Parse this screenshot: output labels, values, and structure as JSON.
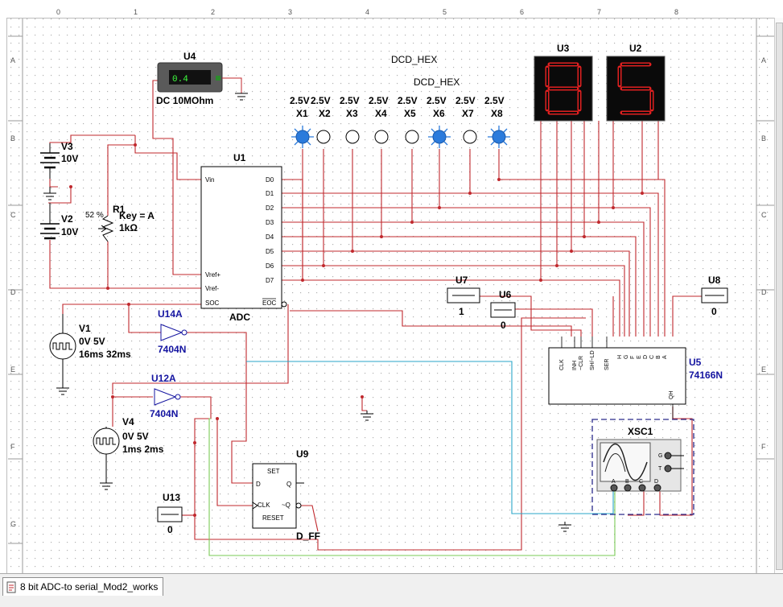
{
  "colors": {
    "wire_red": "#c0282d",
    "wire_blue": "#2aa6c8",
    "wire_green": "#7acb56",
    "probe_blue": "#2b7bdc",
    "segment_red": "#e02020",
    "component_navy": "#1414a0",
    "dashed_border": "#2a2a8a"
  },
  "ruler": {
    "cols": [
      "0",
      "1",
      "2",
      "3",
      "4",
      "5",
      "6",
      "7",
      "8"
    ],
    "rows": [
      "A",
      "B",
      "C",
      "D",
      "E",
      "F",
      "G"
    ]
  },
  "schematic": {
    "u4": {
      "ref": "U4",
      "display": "0.4",
      "desc": "DC  10MOhm"
    },
    "dcd_hex_1": "DCD_HEX",
    "dcd_hex_2": "DCD_HEX",
    "u3": {
      "ref": "U3",
      "digit": "8"
    },
    "u2": {
      "ref": "U2",
      "digit": "5"
    },
    "probes": [
      {
        "volt": "2.5V",
        "name": "X1",
        "lit": true
      },
      {
        "volt": "2.5V",
        "name": "X2",
        "lit": false
      },
      {
        "volt": "2.5V",
        "name": "X3",
        "lit": false
      },
      {
        "volt": "2.5V",
        "name": "X4",
        "lit": false
      },
      {
        "volt": "2.5V",
        "name": "X5",
        "lit": false
      },
      {
        "volt": "2.5V",
        "name": "X6",
        "lit": true
      },
      {
        "volt": "2.5V",
        "name": "X7",
        "lit": false
      },
      {
        "volt": "2.5V",
        "name": "X8",
        "lit": true
      }
    ],
    "u1": {
      "ref": "U1",
      "label": "ADC",
      "pins_left": [
        "Vin",
        "Vref+",
        "Vref-",
        "SOC"
      ],
      "pins_right": [
        "D0",
        "D1",
        "D2",
        "D3",
        "D4",
        "D5",
        "D6",
        "D7",
        "EOC"
      ]
    },
    "v3": {
      "ref": "V3",
      "value": "10V"
    },
    "v2": {
      "ref": "V2",
      "value": "10V"
    },
    "r1": {
      "ref": "R1",
      "percent": "52 %",
      "key": "Key = A",
      "value": "1kΩ"
    },
    "v1": {
      "ref": "V1",
      "line1": "0V 5V",
      "line2": "16ms 32ms"
    },
    "v4": {
      "ref": "V4",
      "line1": "0V 5V",
      "line2": "1ms 2ms"
    },
    "u14a": {
      "ref": "U14A",
      "part": "7404N"
    },
    "u12a": {
      "ref": "U12A",
      "part": "7404N"
    },
    "u7": {
      "ref": "U7",
      "value": "1"
    },
    "u6": {
      "ref": "U6",
      "value": "0"
    },
    "u8": {
      "ref": "U8",
      "value": "0"
    },
    "u13": {
      "ref": "U13",
      "value": "0"
    },
    "u5": {
      "ref": "U5",
      "part": "74166N",
      "pins": [
        "CLK",
        "INH",
        "~CLR",
        "SH/~LD",
        "SER",
        "H",
        "G",
        "F",
        "E",
        "D",
        "C",
        "B",
        "A"
      ],
      "out": "QH"
    },
    "u9": {
      "ref": "U9",
      "part": "D_FF",
      "pin_set": "SET",
      "pin_d": "D",
      "pin_q": "Q",
      "pin_clk": "CLK",
      "pin_nq": "~Q",
      "pin_reset": "RESET"
    },
    "xsc1": {
      "ref": "XSC1",
      "terms": [
        "A",
        "B",
        "C",
        "D"
      ],
      "side": [
        "G",
        "T"
      ]
    }
  },
  "tab": {
    "title": "8 bit ADC-to serial_Mod2_works"
  }
}
